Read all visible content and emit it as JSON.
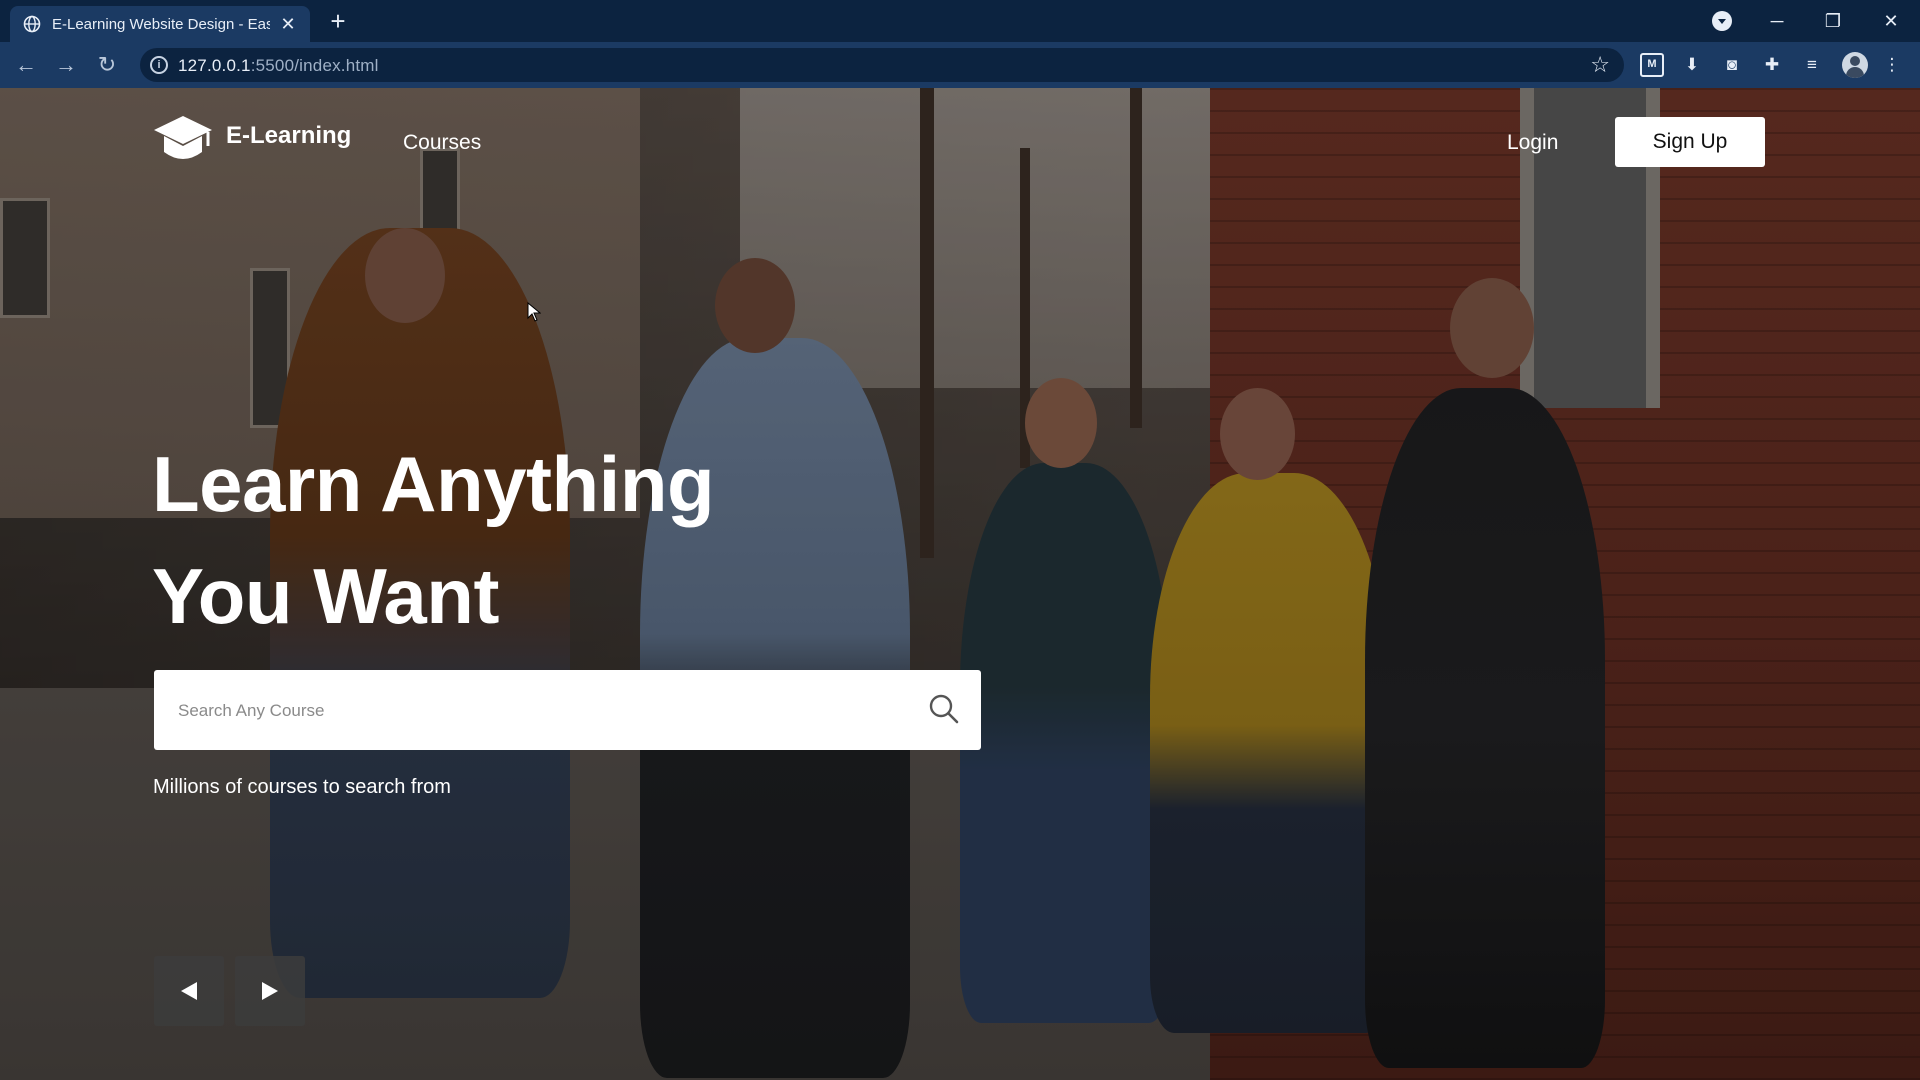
{
  "browser": {
    "tab_title": "E-Learning Website Design - Easy",
    "tab_close": "✕",
    "new_tab": "+",
    "url_host": "127.0.0.1",
    "url_rest": ":5500/index.html",
    "window_controls": {
      "minimize": "─",
      "restore": "❐",
      "close": "✕"
    }
  },
  "header": {
    "logo_text": "E-Learning",
    "nav_courses": "Courses",
    "login": "Login",
    "signup": "Sign Up"
  },
  "hero": {
    "headline_line1": "Learn Anything",
    "headline_line2": "You Want",
    "search_placeholder": "Search Any Course",
    "subtext": "Millions of courses to search from"
  },
  "slider": {
    "prev_icon": "left-triangle-icon",
    "next_icon": "right-triangle-icon"
  },
  "colors": {
    "browser_frame": "#0c2340",
    "toolbar": "#1b3a63",
    "primary_text": "#ffffff",
    "button_bg": "#ffffff"
  }
}
